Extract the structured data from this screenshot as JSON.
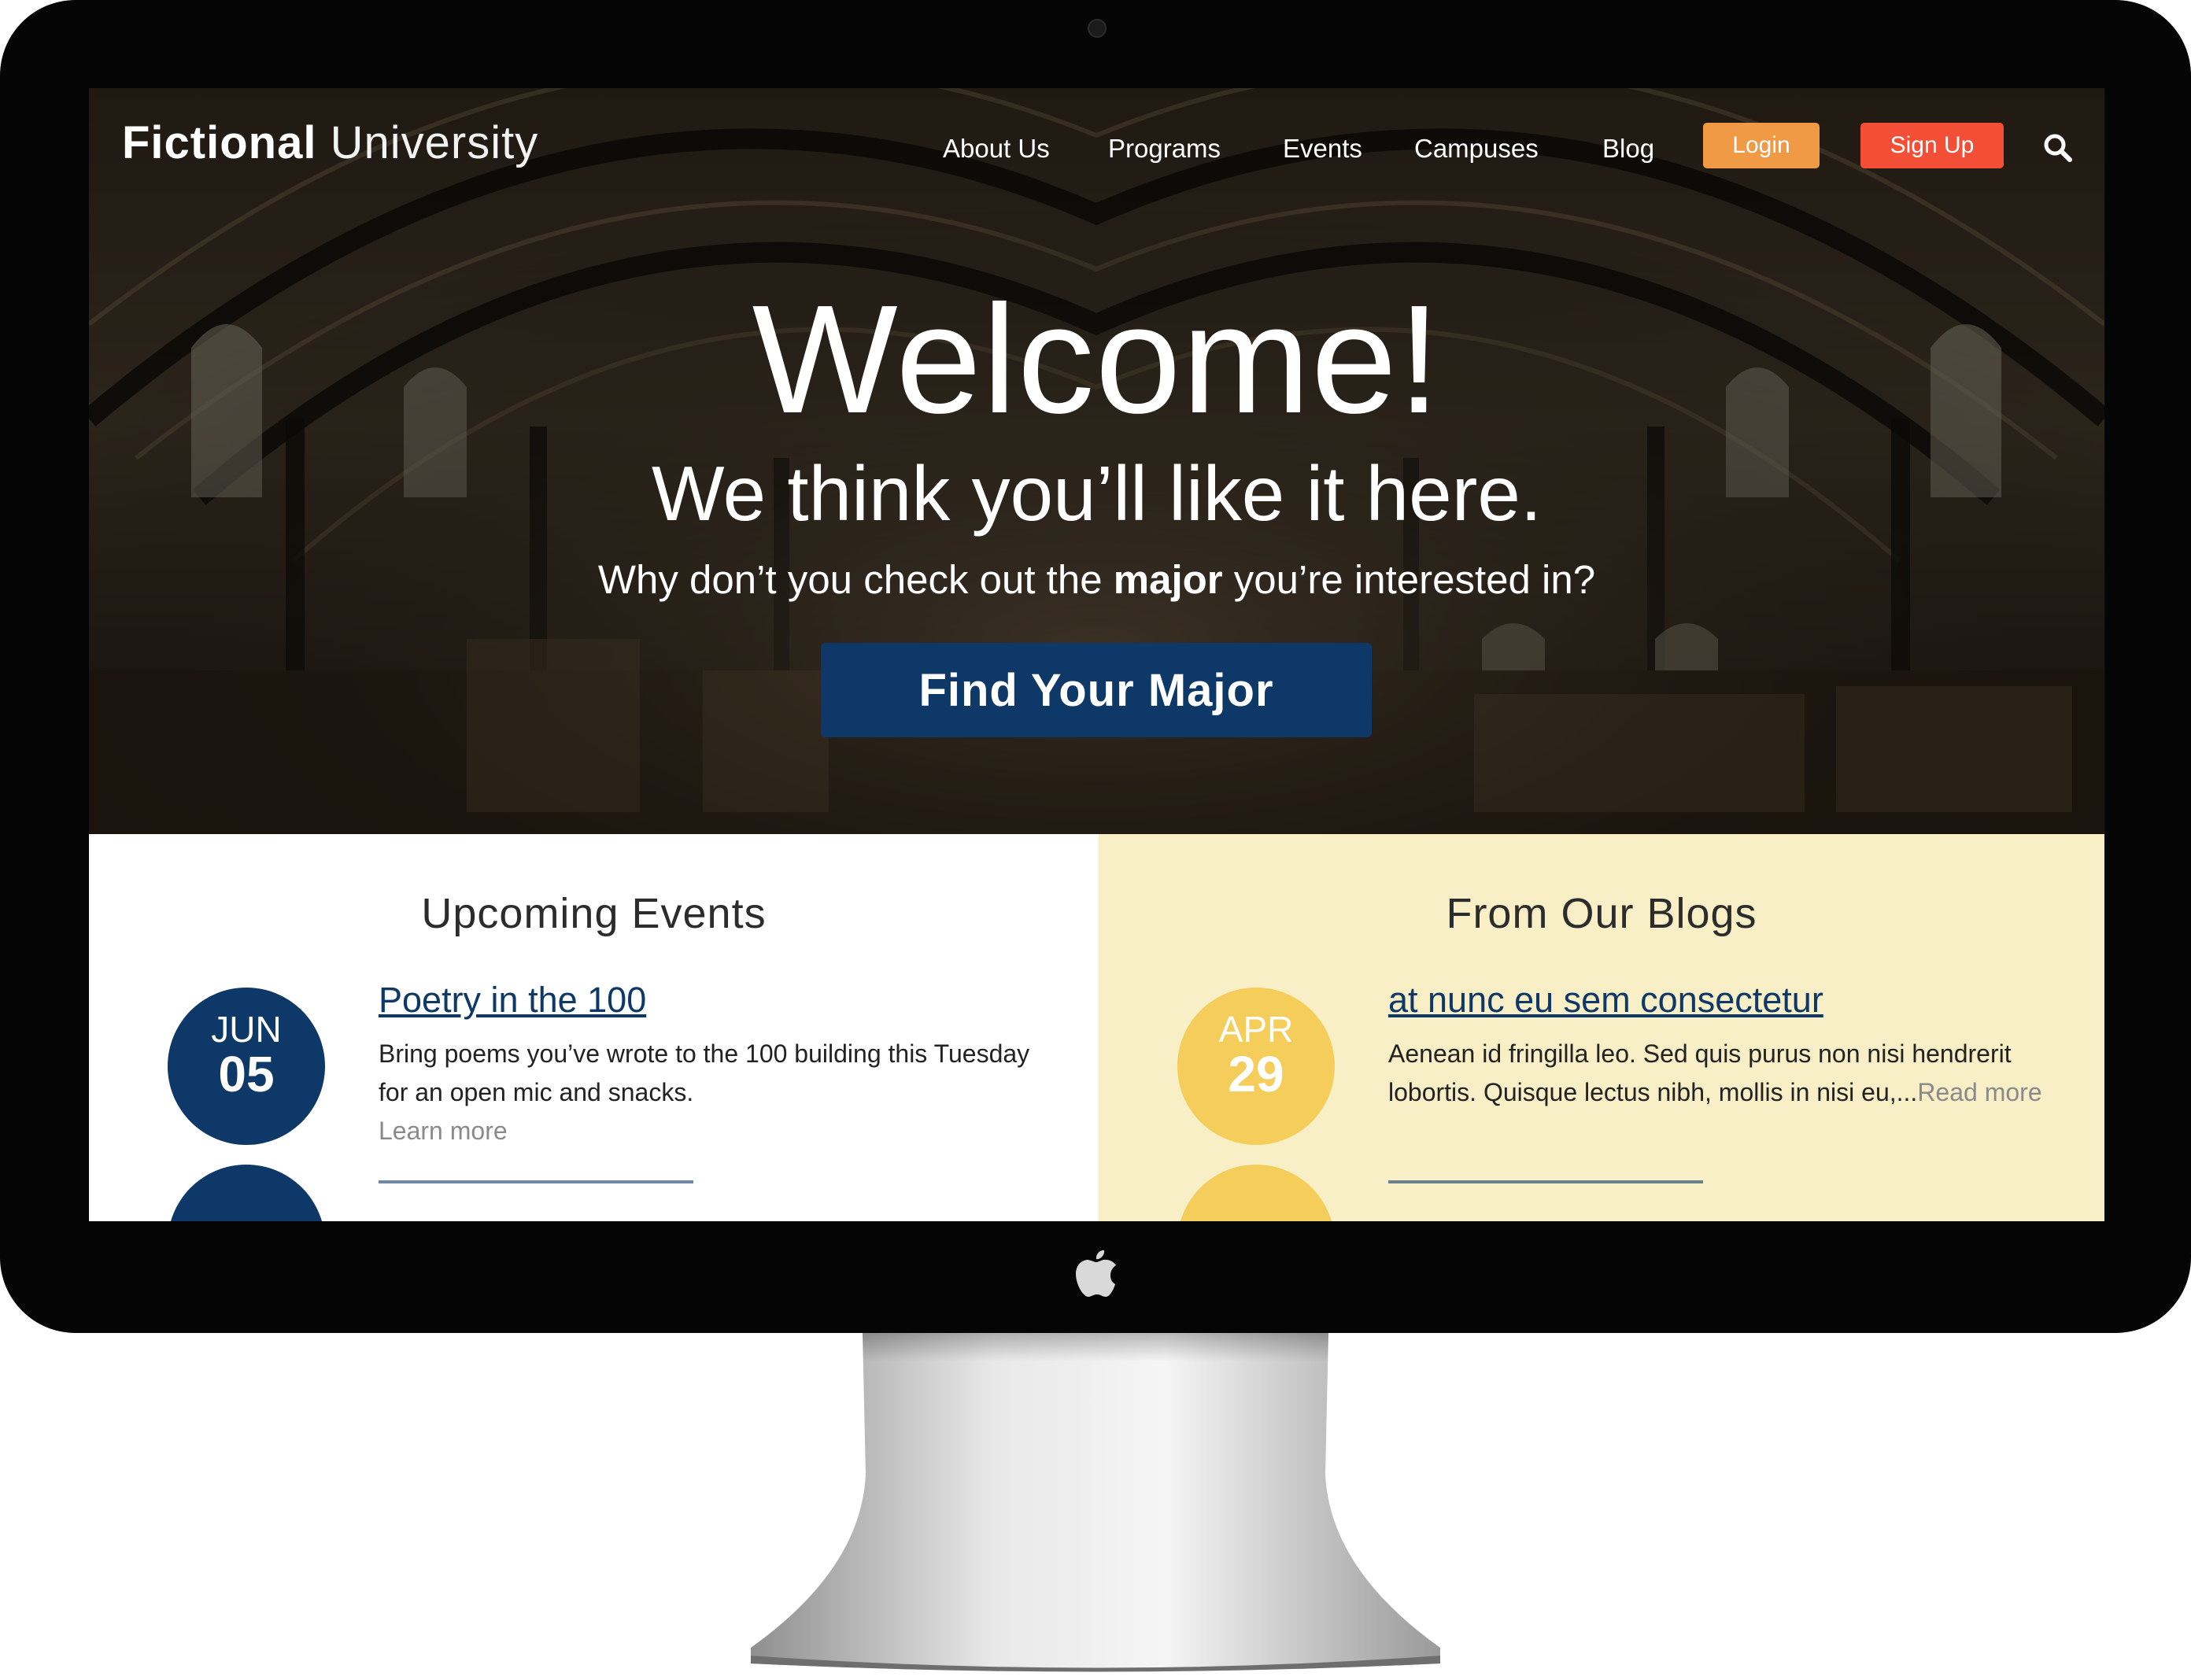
{
  "header": {
    "logo_bold": "Fictional",
    "logo_light": "University",
    "nav": [
      "About Us",
      "Programs",
      "Events",
      "Campuses",
      "Blog"
    ],
    "login_label": "Login",
    "signup_label": "Sign Up",
    "search_icon": "search-icon"
  },
  "hero": {
    "title": "Welcome!",
    "subtitle": "We think you’ll like it here.",
    "line_before": "Why don’t you check out the ",
    "line_bold": "major",
    "line_after": " you’re interested in?",
    "button_label": "Find Your Major"
  },
  "events": {
    "title": "Upcoming Events",
    "items": [
      {
        "month": "JUN",
        "day": "05",
        "title": "Poetry in the 100",
        "body": "Bring poems you’ve wrote to the 100 building this Tuesday for an open mic and snacks.",
        "more": "Learn more"
      }
    ]
  },
  "blogs": {
    "title": "From Our Blogs",
    "items": [
      {
        "month": "APR",
        "day": "29",
        "title": "at nunc eu sem consectetur",
        "body": "Aenean id fringilla leo. Sed quis purus non nisi hendrerit lobortis. Quisque lectus nibh, mollis in nisi eu,...",
        "more": "Read more"
      }
    ]
  },
  "colors": {
    "brand_blue": "#0d3868",
    "login_orange": "#f09a45",
    "signup_red": "#f34f36",
    "blog_bg": "#f8efc6",
    "badge_gold": "#f4cd5a"
  }
}
